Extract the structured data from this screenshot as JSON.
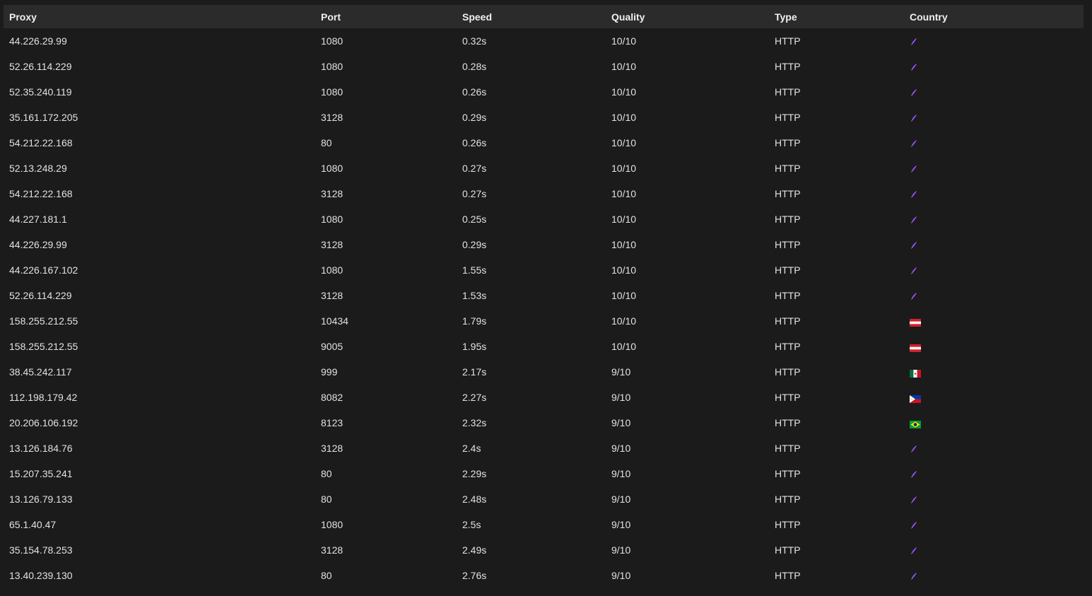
{
  "table": {
    "headers": {
      "proxy": "Proxy",
      "port": "Port",
      "speed": "Speed",
      "quality": "Quality",
      "type": "Type",
      "country": "Country"
    },
    "rows": [
      {
        "proxy": "44.226.29.99",
        "port": "1080",
        "speed": "0.32s",
        "quality": "10/10",
        "type": "HTTP",
        "flag": "unknown-flag-icon"
      },
      {
        "proxy": "52.26.114.229",
        "port": "1080",
        "speed": "0.28s",
        "quality": "10/10",
        "type": "HTTP",
        "flag": "unknown-flag-icon"
      },
      {
        "proxy": "52.35.240.119",
        "port": "1080",
        "speed": "0.26s",
        "quality": "10/10",
        "type": "HTTP",
        "flag": "unknown-flag-icon"
      },
      {
        "proxy": "35.161.172.205",
        "port": "3128",
        "speed": "0.29s",
        "quality": "10/10",
        "type": "HTTP",
        "flag": "unknown-flag-icon"
      },
      {
        "proxy": "54.212.22.168",
        "port": "80",
        "speed": "0.26s",
        "quality": "10/10",
        "type": "HTTP",
        "flag": "unknown-flag-icon"
      },
      {
        "proxy": "52.13.248.29",
        "port": "1080",
        "speed": "0.27s",
        "quality": "10/10",
        "type": "HTTP",
        "flag": "unknown-flag-icon"
      },
      {
        "proxy": "54.212.22.168",
        "port": "3128",
        "speed": "0.27s",
        "quality": "10/10",
        "type": "HTTP",
        "flag": "unknown-flag-icon"
      },
      {
        "proxy": "44.227.181.1",
        "port": "1080",
        "speed": "0.25s",
        "quality": "10/10",
        "type": "HTTP",
        "flag": "unknown-flag-icon"
      },
      {
        "proxy": "44.226.29.99",
        "port": "3128",
        "speed": "0.29s",
        "quality": "10/10",
        "type": "HTTP",
        "flag": "unknown-flag-icon"
      },
      {
        "proxy": "44.226.167.102",
        "port": "1080",
        "speed": "1.55s",
        "quality": "10/10",
        "type": "HTTP",
        "flag": "unknown-flag-icon"
      },
      {
        "proxy": "52.26.114.229",
        "port": "3128",
        "speed": "1.53s",
        "quality": "10/10",
        "type": "HTTP",
        "flag": "unknown-flag-icon"
      },
      {
        "proxy": "158.255.212.55",
        "port": "10434",
        "speed": "1.79s",
        "quality": "10/10",
        "type": "HTTP",
        "flag": "austria-flag-icon"
      },
      {
        "proxy": "158.255.212.55",
        "port": "9005",
        "speed": "1.95s",
        "quality": "10/10",
        "type": "HTTP",
        "flag": "austria-flag-icon"
      },
      {
        "proxy": "38.45.242.117",
        "port": "999",
        "speed": "2.17s",
        "quality": "9/10",
        "type": "HTTP",
        "flag": "mexico-flag-icon"
      },
      {
        "proxy": "112.198.179.42",
        "port": "8082",
        "speed": "2.27s",
        "quality": "9/10",
        "type": "HTTP",
        "flag": "philippines-flag-icon"
      },
      {
        "proxy": "20.206.106.192",
        "port": "8123",
        "speed": "2.32s",
        "quality": "9/10",
        "type": "HTTP",
        "flag": "brazil-flag-icon"
      },
      {
        "proxy": "13.126.184.76",
        "port": "3128",
        "speed": "2.4s",
        "quality": "9/10",
        "type": "HTTP",
        "flag": "unknown-flag-icon"
      },
      {
        "proxy": "15.207.35.241",
        "port": "80",
        "speed": "2.29s",
        "quality": "9/10",
        "type": "HTTP",
        "flag": "unknown-flag-icon"
      },
      {
        "proxy": "13.126.79.133",
        "port": "80",
        "speed": "2.48s",
        "quality": "9/10",
        "type": "HTTP",
        "flag": "unknown-flag-icon"
      },
      {
        "proxy": "65.1.40.47",
        "port": "1080",
        "speed": "2.5s",
        "quality": "9/10",
        "type": "HTTP",
        "flag": "unknown-flag-icon"
      },
      {
        "proxy": "35.154.78.253",
        "port": "3128",
        "speed": "2.49s",
        "quality": "9/10",
        "type": "HTTP",
        "flag": "unknown-flag-icon"
      },
      {
        "proxy": "13.40.239.130",
        "port": "80",
        "speed": "2.76s",
        "quality": "9/10",
        "type": "HTTP",
        "flag": "unknown-flag-icon"
      }
    ]
  },
  "colors": {
    "background": "#1b1b1b",
    "header_background": "#2b2b2b",
    "text": "#e2e2e2",
    "unknown_flag_accent": "#7a2cf0"
  }
}
